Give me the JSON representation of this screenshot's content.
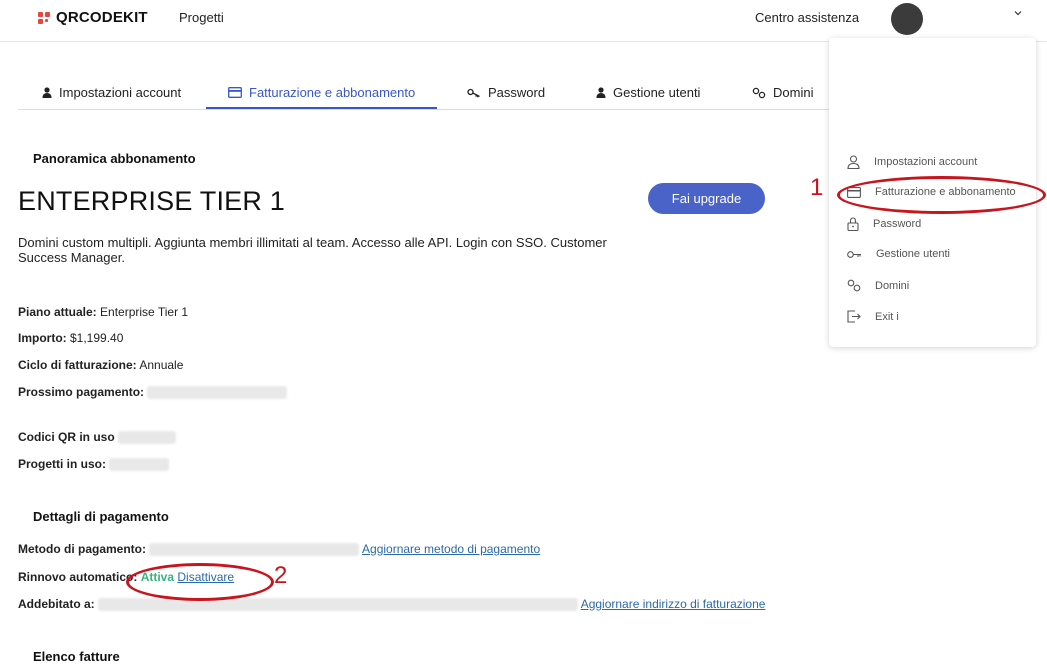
{
  "topbar": {
    "brand": "QRCODEKIT",
    "projects_label": "Progetti",
    "help_label": "Centro assistenza"
  },
  "tabs": [
    {
      "label": "Impostazioni account",
      "icon": "user-icon"
    },
    {
      "label": "Fatturazione e abbonamento",
      "icon": "credit-card-icon",
      "active": true
    },
    {
      "label": "Password",
      "icon": "key-icon"
    },
    {
      "label": "Gestione utenti",
      "icon": "user-icon"
    },
    {
      "label": "Domini",
      "icon": "link-icon"
    }
  ],
  "subscription": {
    "section_title": "Panoramica abbonamento",
    "plan_name": "ENTERPRISE TIER 1",
    "upgrade_label": "Fai upgrade",
    "description": "Domini custom multipli. Aggiunta membri illimitati al team. Accesso alle API. Login con SSO. Customer Success Manager.",
    "current_plan_label": "Piano attuale:",
    "current_plan_value": "Enterprise Tier 1",
    "amount_label": "Importo:",
    "amount_value": "$1,199.40",
    "cycle_label": "Ciclo di fatturazione:",
    "cycle_value": "Annuale",
    "next_payment_label": "Prossimo pagamento:",
    "qr_in_use_label": "Codici QR in uso",
    "projects_in_use_label": "Progetti in uso:"
  },
  "payment": {
    "section_title": "Dettagli di pagamento",
    "method_label": "Metodo di pagamento:",
    "update_method_link": "Aggiornare metodo di pagamento",
    "autorenew_label": "Rinnovo automatico:",
    "autorenew_status": "Attiva",
    "disable_link": "Disattivare",
    "billed_to_label": "Addebitato a:",
    "update_address_link": "Aggiornare indirizzo di fatturazione"
  },
  "invoices": {
    "section_title": "Elenco fatture"
  },
  "dropdown_menu": {
    "items": [
      {
        "label": "Impostazioni account",
        "icon": "user-icon"
      },
      {
        "label": "Fatturazione e abbonamento",
        "icon": "credit-card-icon"
      },
      {
        "label": "Password",
        "icon": "lock-icon"
      },
      {
        "label": "Gestione utenti",
        "icon": "key-icon"
      },
      {
        "label": "Domini",
        "icon": "link-icon"
      },
      {
        "label": "Exit i",
        "icon": "logout-icon"
      }
    ]
  },
  "annotations": {
    "step1": "1",
    "step2": "2",
    "color": "#c8141c"
  },
  "colors": {
    "accent": "#3a57c9",
    "button": "#4a63c9",
    "link": "#2a6aa8",
    "active_status": "#36b37e",
    "logo": "#e8453c"
  }
}
